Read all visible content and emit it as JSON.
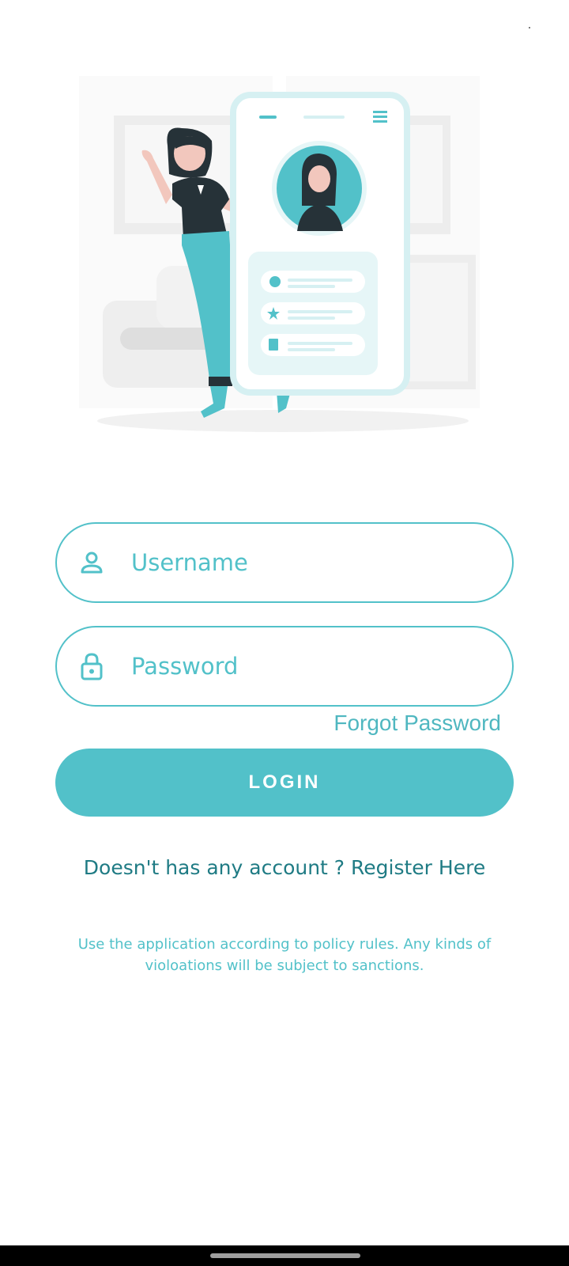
{
  "form": {
    "username_placeholder": "Username",
    "password_placeholder": "Password",
    "forgot_label": "Forgot Password",
    "login_label": "LOGIN"
  },
  "register": {
    "prompt": "Doesn't has any account ?",
    "link_label": "Register Here"
  },
  "policy_text": "Use the application according to policy rules. Any kinds of violoations will be subject to sanctions.",
  "icons": {
    "username": "user-icon",
    "password": "lock-icon"
  },
  "colors": {
    "accent": "#52c1c9",
    "text_dark_teal": "#1f7b84",
    "background": "#ffffff"
  }
}
